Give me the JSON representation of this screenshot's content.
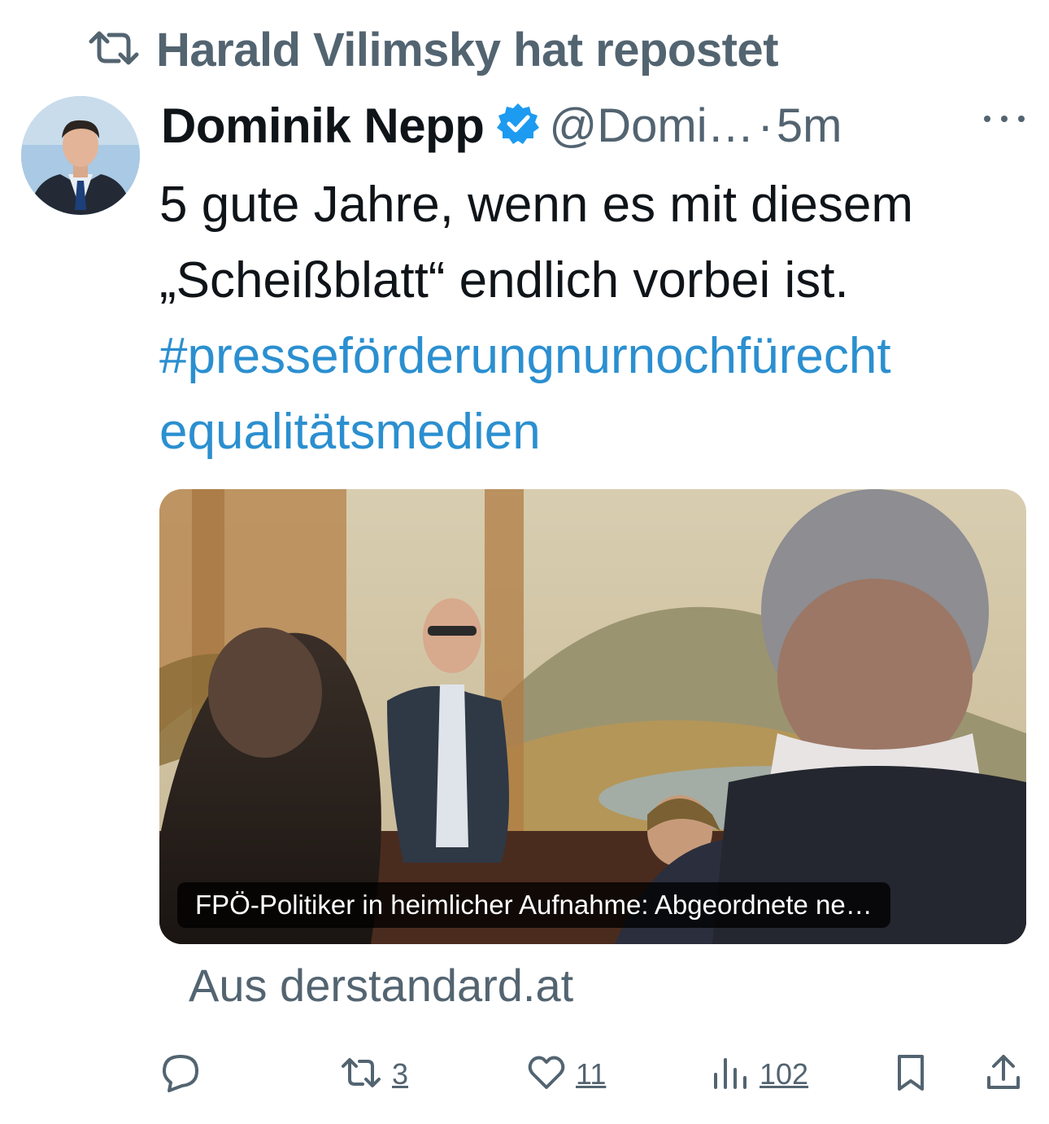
{
  "repost": {
    "text": "Harald Vilimsky hat repostet",
    "icon": "repost-icon"
  },
  "post": {
    "author": "Dominik Nepp",
    "verified": true,
    "handle": "@Domi…",
    "separator": "·",
    "time": "5m",
    "text_lines": [
      "5 gute Jahre, wenn es mit diesem",
      "„Scheißblatt“ endlich vorbei ist."
    ],
    "hashtag_lines": [
      "#presseförderungnurnochfürecht",
      "equalitätsmedien"
    ]
  },
  "card": {
    "caption": "FPÖ-Politiker in heimlicher Aufnahme: Abgeordnete ne…",
    "source": "Aus derstandard.at"
  },
  "actions": {
    "reply": {
      "icon": "reply-icon",
      "count": ""
    },
    "repost": {
      "icon": "repost-icon",
      "count": "3"
    },
    "like": {
      "icon": "heart-icon",
      "count": "11"
    },
    "views": {
      "icon": "views-icon",
      "count": "102"
    },
    "bookmark": {
      "icon": "bookmark-icon"
    },
    "share": {
      "icon": "share-icon"
    }
  },
  "colors": {
    "muted": "#536471",
    "link": "#1d9bf0",
    "verified": "#1d9bf0",
    "text": "#0f1419"
  }
}
